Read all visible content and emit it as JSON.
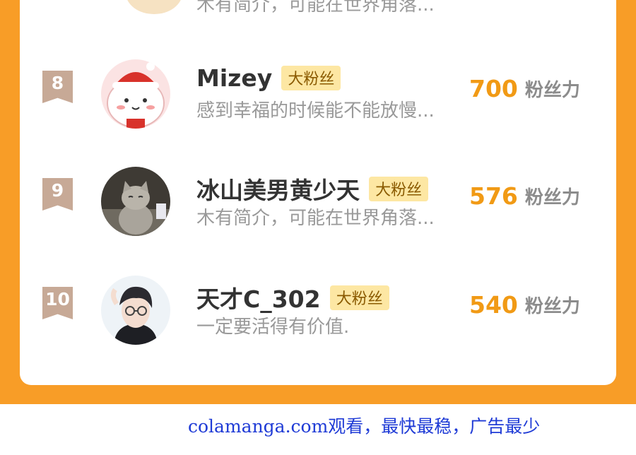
{
  "leaderboard": {
    "partial_bio": "木有简介，可能在世界角落...",
    "unit_label": "粉丝力",
    "rows": [
      {
        "rank": "8",
        "name": "Mizey",
        "badge": "大粉丝",
        "bio": "感到幸福的时候能不能放慢...",
        "score": "700",
        "avatar_icon": "bear-santa-hat-avatar"
      },
      {
        "rank": "9",
        "name": "冰山美男黄少天",
        "badge": "大粉丝",
        "bio": "木有简介，可能在世界角落...",
        "score": "576",
        "avatar_icon": "gray-cat-avatar"
      },
      {
        "rank": "10",
        "name": "天才C_302",
        "badge": "大粉丝",
        "bio": "一定要活得有价值.",
        "score": "540",
        "avatar_icon": "anime-boy-avatar"
      }
    ]
  },
  "footer": {
    "text": "colamanga.com观看，最快最稳，广告最少"
  },
  "colors": {
    "frame": "#f89d27",
    "badge": "#fde7a3",
    "score": "#f19a15",
    "rank_ribbon": "#c7a996"
  }
}
